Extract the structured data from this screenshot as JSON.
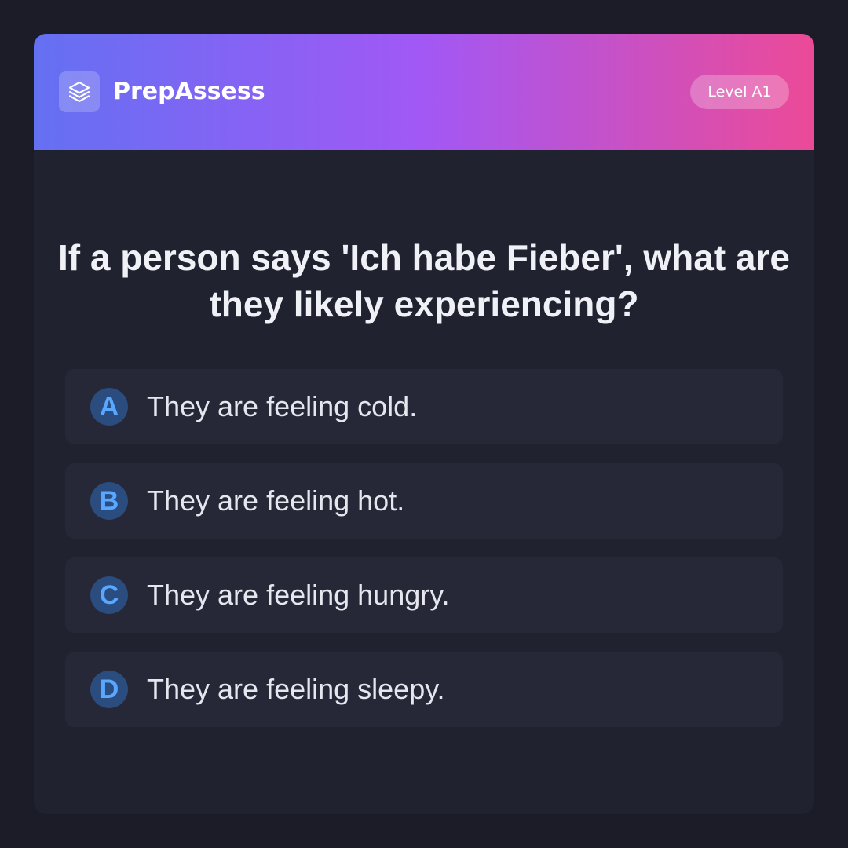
{
  "header": {
    "brand": "PrepAssess",
    "logo_icon": "layers-icon",
    "level": "Level A1"
  },
  "question": "If a person says 'Ich habe Fieber', what are they likely experiencing?",
  "options": [
    {
      "letter": "A",
      "text": "They are feeling cold."
    },
    {
      "letter": "B",
      "text": "They are feeling hot."
    },
    {
      "letter": "C",
      "text": "They are feeling hungry."
    },
    {
      "letter": "D",
      "text": "They are feeling sleepy."
    }
  ],
  "colors": {
    "gradient_start": "#6470f2",
    "gradient_mid": "#a258f5",
    "gradient_end": "#ec4a97",
    "letter_color": "#5aa7ff"
  }
}
